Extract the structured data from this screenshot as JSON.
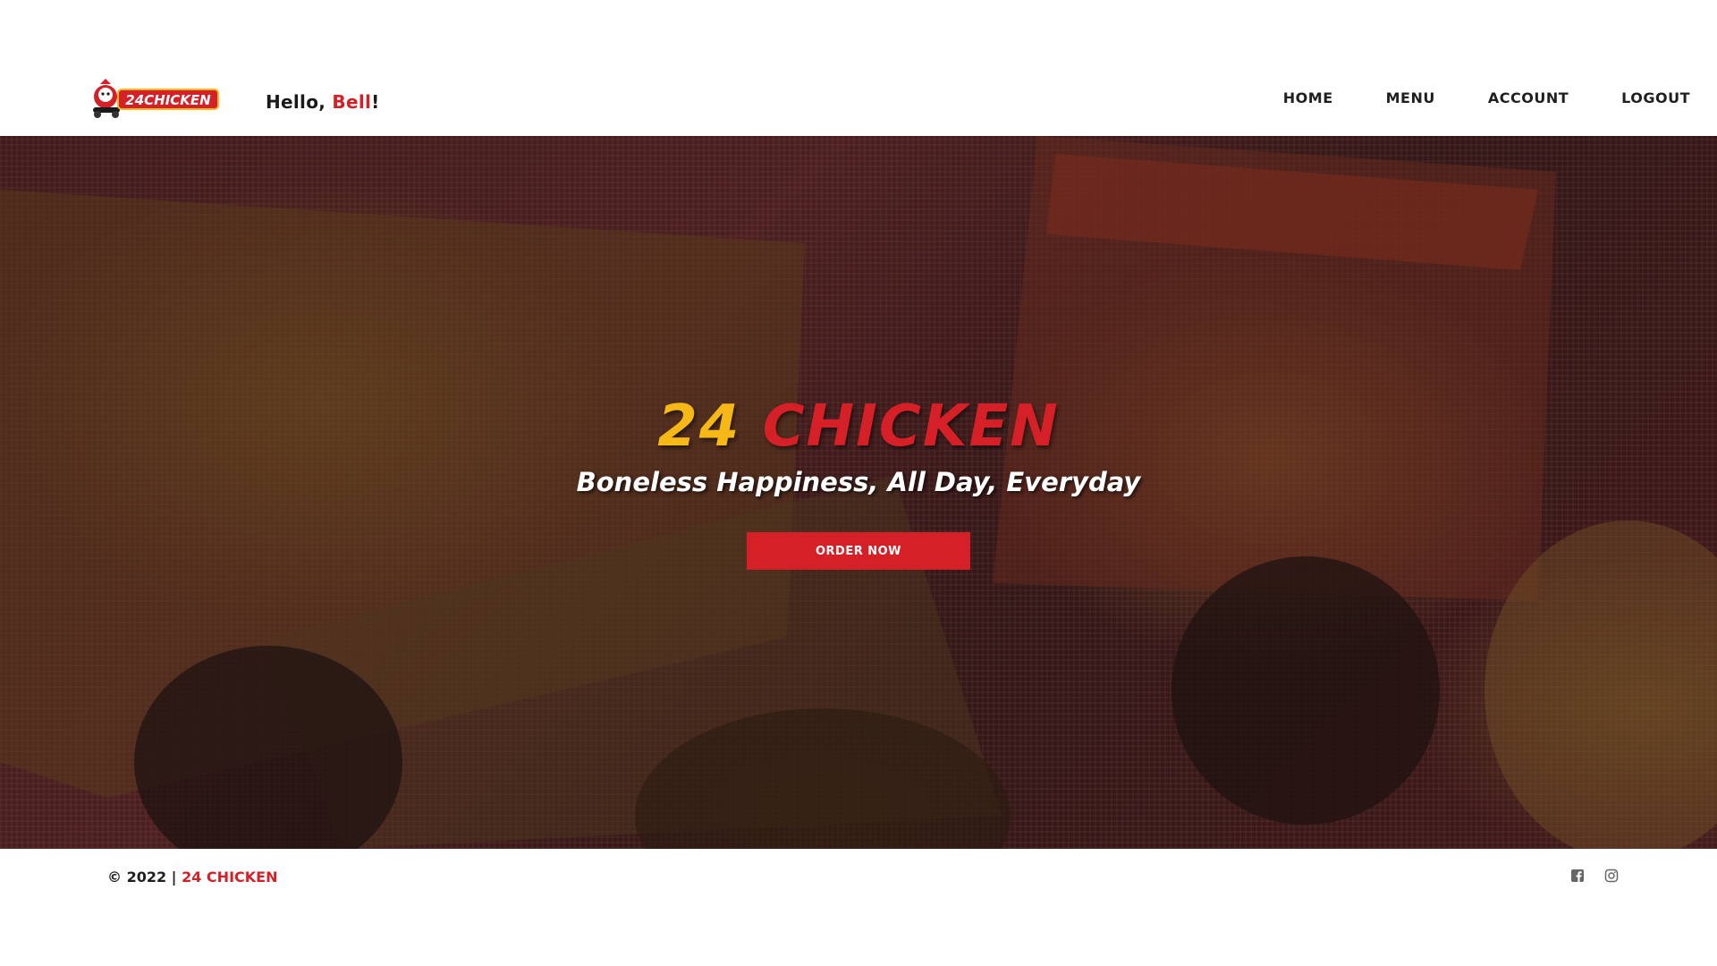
{
  "header": {
    "logo_text": "24CHICKEN",
    "greeting_prefix": "Hello, ",
    "user_name": "Bell",
    "greeting_suffix": "!",
    "nav": [
      {
        "label": "HOME"
      },
      {
        "label": "MENU"
      },
      {
        "label": "ACCOUNT"
      },
      {
        "label": "LOGOUT"
      }
    ]
  },
  "hero": {
    "brand_number": "24",
    "brand_word": "CHICKEN",
    "tagline": "Boneless Happiness, All Day, Everyday",
    "cta_label": "ORDER NOW"
  },
  "footer": {
    "copyright_prefix": "© 2022 | ",
    "copyright_brand": "24 CHICKEN",
    "social_icons": [
      "facebook-icon",
      "instagram-icon"
    ]
  },
  "colors": {
    "accent": "#d42026",
    "brand_yellow": "#f6b817",
    "text_dark": "#1f1f1f"
  }
}
